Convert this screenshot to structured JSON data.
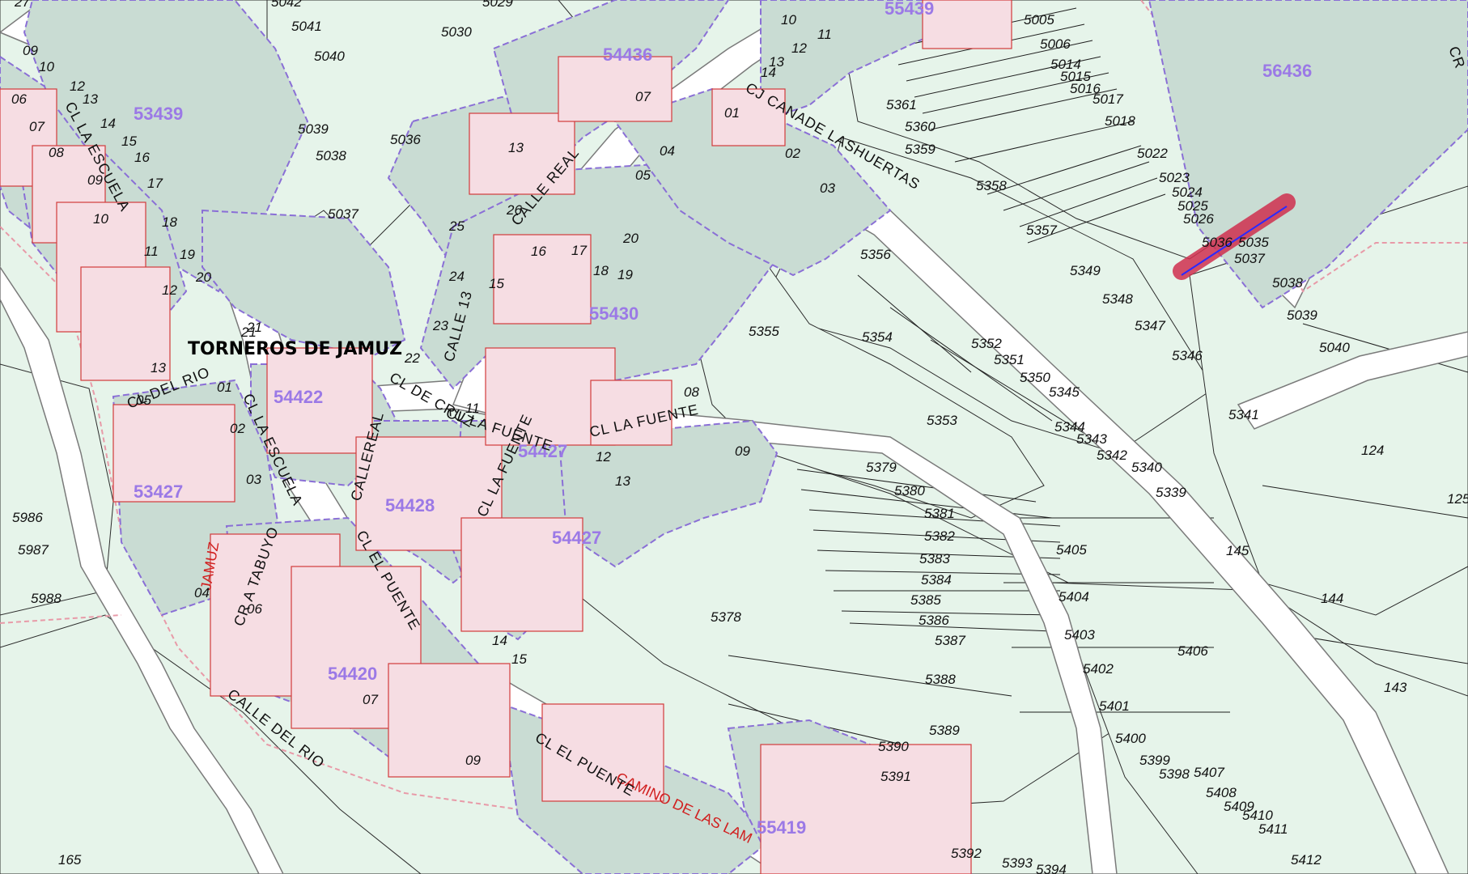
{
  "map": {
    "town_name": "TORNEROS DE JAMUZ",
    "colors": {
      "background": "#e8f5ec",
      "road": "#ffffff",
      "block_fill": "#c9dcd3",
      "block_border": "#8a6fd6",
      "built_fill": "#f6dde3",
      "built_border": "#d13b3b",
      "highlight": "#d0304f",
      "block_label": "#9b79e6"
    },
    "highlight_parcel": "5036",
    "red_labels": [
      "JAMUZ",
      "CAMINO DE LAS LAM"
    ],
    "block_codes": [
      "53439",
      "54436",
      "55439",
      "56436",
      "55430",
      "54422",
      "54427",
      "53427",
      "54428",
      "54420",
      "55419",
      "54427"
    ],
    "street_labels": [
      "CL LA ESCUELA",
      "CALLE REAL",
      "CJ CANADE LASHUERTAS",
      "CL DE CRUZ",
      "CALLE 13",
      "CL DEL RIO",
      "CL LA ESCUELA",
      "CL LA FUENTE",
      "CL LA FUENTE",
      "CL LA FUENTE",
      "CALLEREAL",
      "CR A TABUYO",
      "CL EL PUENTE",
      "CALLE DEL RIO",
      "CL EL PUENTE",
      "CR"
    ],
    "parcels": [
      "5041",
      "5040",
      "5039",
      "5038",
      "5037",
      "5036",
      "5030",
      "5029",
      "5042",
      "5005",
      "5006",
      "5014",
      "5015",
      "5016",
      "5017",
      "5018",
      "5022",
      "5023",
      "5024",
      "5025",
      "5026",
      "5035",
      "5037",
      "5038",
      "5039",
      "5040",
      "5361",
      "5360",
      "5359",
      "5358",
      "5357",
      "5356",
      "5355",
      "5354",
      "5353",
      "5352",
      "5351",
      "5350",
      "5349",
      "5348",
      "5347",
      "5346",
      "5345",
      "5344",
      "5343",
      "5342",
      "5341",
      "5340",
      "5339",
      "5379",
      "5380",
      "5381",
      "5382",
      "5383",
      "5384",
      "5385",
      "5386",
      "5387",
      "5388",
      "5389",
      "5390",
      "5391",
      "5392",
      "5393",
      "5394",
      "5378",
      "5405",
      "5404",
      "5403",
      "5402",
      "5401",
      "5400",
      "5399",
      "5398",
      "5407",
      "5406",
      "5408",
      "5409",
      "5410",
      "5411",
      "5412",
      "5986",
      "5987",
      "5988",
      "165",
      "124",
      "125",
      "145",
      "144",
      "143"
    ],
    "house_numbers": [
      "27",
      "09",
      "10",
      "12",
      "13",
      "14",
      "15",
      "16",
      "17",
      "18",
      "19",
      "20",
      "21",
      "06",
      "07",
      "08",
      "09",
      "10",
      "11",
      "12",
      "13",
      "01",
      "02",
      "03",
      "04",
      "05",
      "06",
      "07",
      "09",
      "13",
      "14",
      "11",
      "12",
      "13",
      "15",
      "16",
      "17",
      "18",
      "19",
      "20",
      "21",
      "22",
      "23",
      "24",
      "25",
      "26",
      "01",
      "02",
      "03",
      "04",
      "05",
      "07",
      "08",
      "09",
      "10",
      "11",
      "12",
      "13",
      "14",
      "15"
    ]
  }
}
